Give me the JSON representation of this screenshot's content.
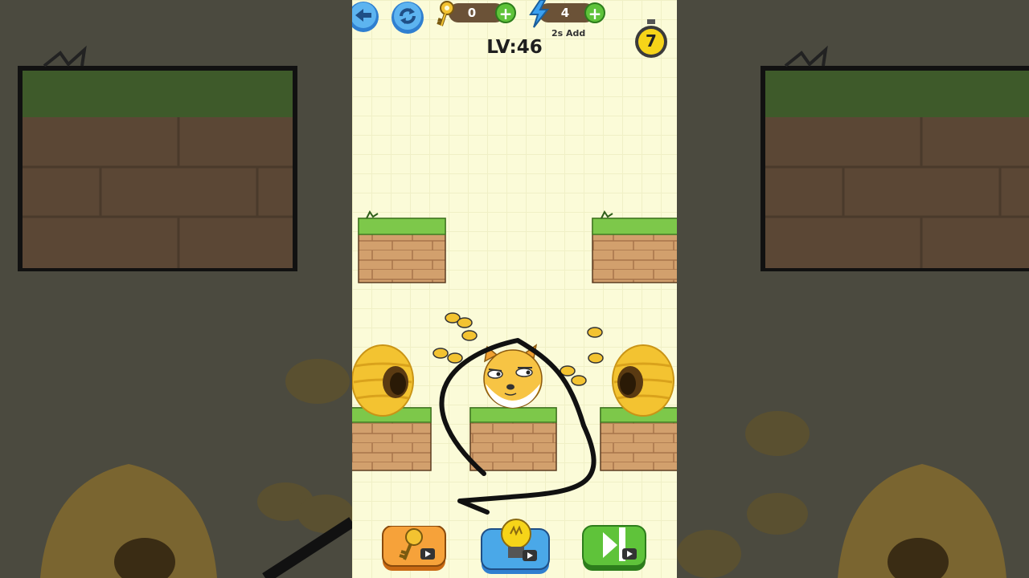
{
  "hud": {
    "keys_count": "0",
    "energy_count": "4",
    "energy_note": "2s Add",
    "level_label": "LV:46",
    "timer_value": "7"
  },
  "icons": {
    "back": "back-arrow-icon",
    "restart": "restart-icon",
    "key": "key-icon",
    "energy": "lightning-icon",
    "timer": "stopwatch-icon",
    "hint": "lightbulb-icon",
    "skip": "skip-icon",
    "video": "video-ad-icon"
  },
  "colors": {
    "background": "#fbfbd8",
    "grass": "#7dc84a",
    "brick": "#d2a06d",
    "hud_pill": "#6b5237",
    "plus_green": "#5fc33a",
    "key_button": "#f6a23a",
    "hint_button": "#4aa8e8",
    "skip_button": "#5fc33a"
  }
}
